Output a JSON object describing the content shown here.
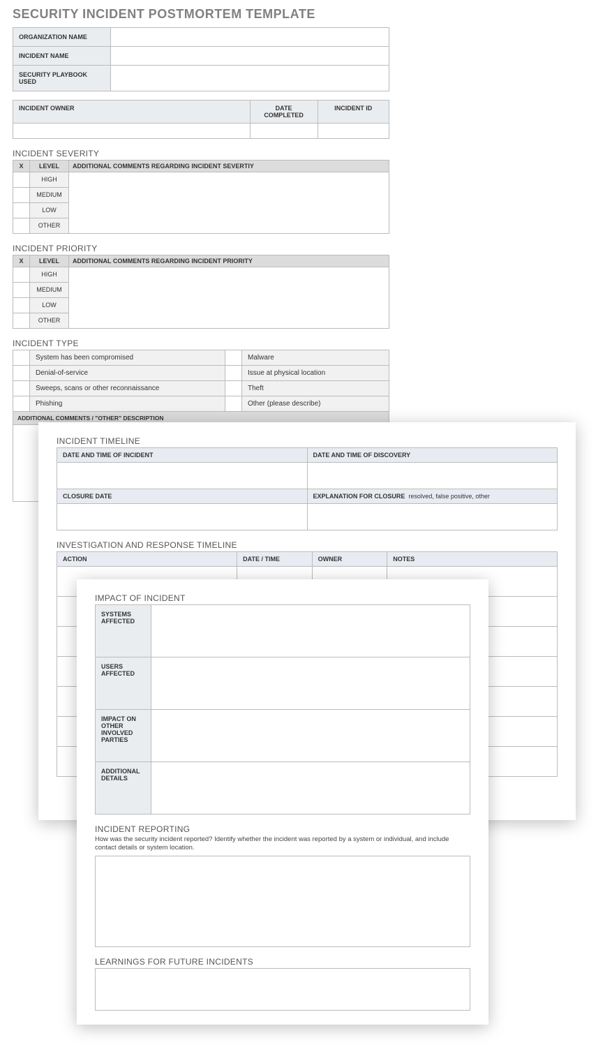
{
  "title": "SECURITY INCIDENT POSTMORTEM TEMPLATE",
  "meta_rows": {
    "org": "ORGANIZATION NAME",
    "incident": "INCIDENT NAME",
    "playbook": "SECURITY PLAYBOOK USED"
  },
  "owner_row": {
    "owner": "INCIDENT OWNER",
    "date": "DATE COMPLETED",
    "id": "INCIDENT ID"
  },
  "severity": {
    "title": "INCIDENT SEVERITY",
    "x": "X",
    "level": "LEVEL",
    "comments_hdr": "ADDITIONAL COMMENTS REGARDING INCIDENT SEVERTIY",
    "levels": [
      "HIGH",
      "MEDIUM",
      "LOW",
      "OTHER"
    ]
  },
  "priority": {
    "title": "INCIDENT PRIORITY",
    "x": "X",
    "level": "LEVEL",
    "comments_hdr": "ADDITIONAL COMMENTS REGARDING INCIDENT PRIORITY",
    "levels": [
      "HIGH",
      "MEDIUM",
      "LOW",
      "OTHER"
    ]
  },
  "type": {
    "title": "INCIDENT TYPE",
    "left": [
      "System has been compromised",
      "Denial-of-service",
      "Sweeps, scans or other reconnaissance",
      "Phishing"
    ],
    "right": [
      "Malware",
      "Issue at physical location",
      "Theft",
      "Other (please describe)"
    ],
    "other_hdr": "ADDITIONAL COMMENTS / \"OTHER\" DESCRIPTION"
  },
  "timeline": {
    "title": "INCIDENT TIMELINE",
    "dt_incident": "DATE AND TIME OF INCIDENT",
    "dt_discovery": "DATE AND TIME OF DISCOVERY",
    "closure": "CLOSURE DATE",
    "explanation_label": "EXPLANATION FOR CLOSURE",
    "explanation_hint": "resolved, false positive, other"
  },
  "invest": {
    "title": "INVESTIGATION AND RESPONSE TIMELINE",
    "cols": {
      "action": "ACTION",
      "dt": "DATE / TIME",
      "owner": "OWNER",
      "notes": "NOTES"
    }
  },
  "impact": {
    "title": "IMPACT OF INCIDENT",
    "rows": [
      "SYSTEMS AFFECTED",
      "USERS AFFECTED",
      "IMPACT ON OTHER INVOLVED PARTIES",
      "ADDITIONAL DETAILS"
    ]
  },
  "reporting": {
    "title": "INCIDENT REPORTING",
    "sub": "How was the security incident reported? Identify whether the incident was reported by a system or individual, and include contact details or system location."
  },
  "learnings": {
    "title": "LEARNINGS FOR FUTURE INCIDENTS"
  }
}
